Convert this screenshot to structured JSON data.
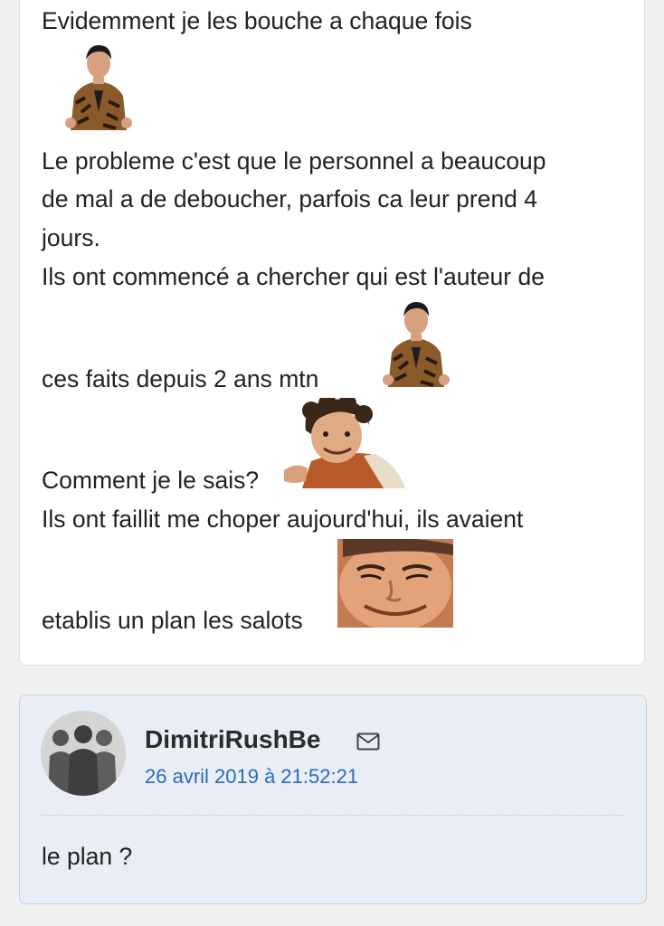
{
  "post": {
    "lines": [
      "Evidemment je les bouche a chaque fois",
      "Le probleme c'est que le personnel a beaucoup",
      "de mal a de deboucher, parfois ca leur prend 4",
      "jours.",
      "Ils ont commencé a chercher qui est l'auteur de",
      "ces faits depuis 2 ans mtn",
      "Comment je le sais?",
      "Ils ont faillit me choper aujourd'hui, ils avaient",
      "etablis un plan les salots"
    ]
  },
  "reply": {
    "username": "DimitriRushBe",
    "date": "26 avril 2019 à 21:52:21",
    "text": "le plan ?",
    "mail_icon": "envelope-icon",
    "avatar_icon": "group-silhouette-avatar"
  }
}
